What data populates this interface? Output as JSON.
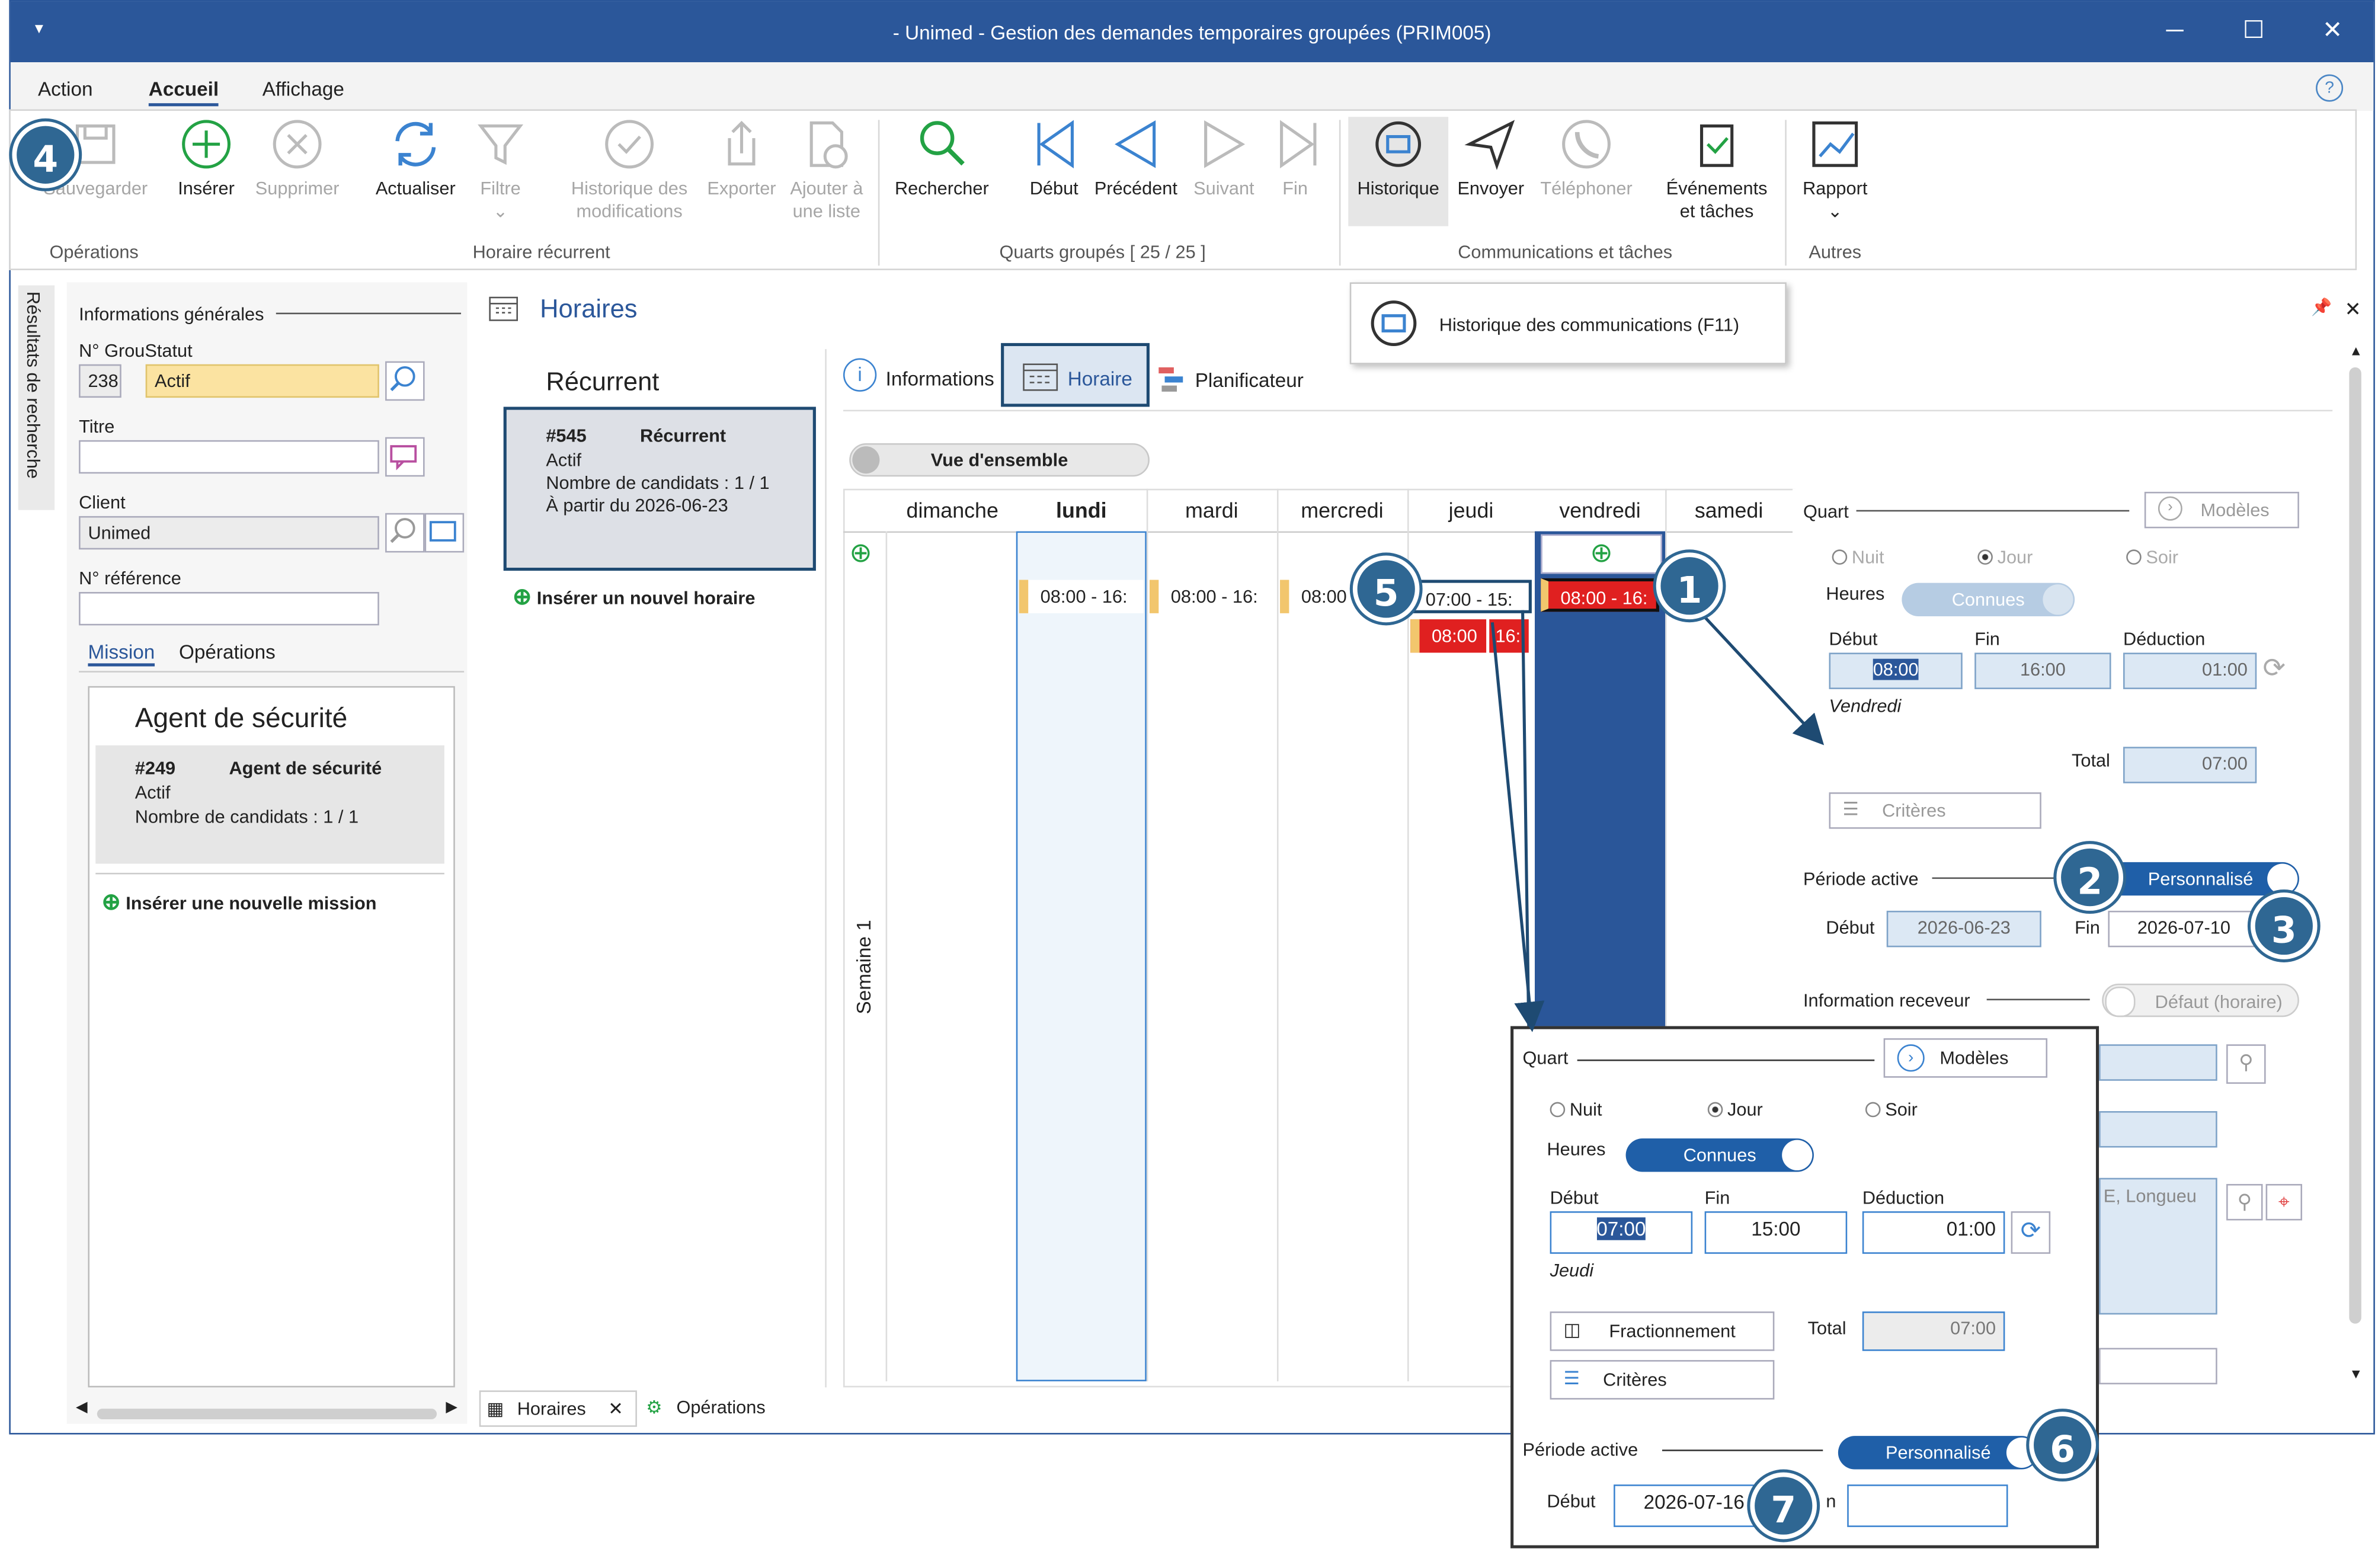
{
  "window": {
    "title": "- Unimed - Gestion des demandes temporaires groupées (PRIM005)",
    "minimize": "─",
    "maximize": "☐",
    "close": "✕",
    "quick": "▾"
  },
  "menu": {
    "items": [
      "Action",
      "Accueil",
      "Affichage"
    ],
    "help": "?"
  },
  "ribbon": {
    "save": "Sauvegarder",
    "insert": "Insérer",
    "delete": "Supprimer",
    "refresh": "Actualiser",
    "filter": "Filtre",
    "history_mod": [
      "Historique des",
      "modifications"
    ],
    "export": "Exporter",
    "add_list": [
      "Ajouter à",
      "une liste"
    ],
    "search": "Rechercher",
    "first": "Début",
    "previous": "Précédent",
    "next": "Suivant",
    "last": "Fin",
    "history": "Historique",
    "send": "Envoyer",
    "phone": "Téléphoner",
    "events": [
      "Événements",
      "et tâches"
    ],
    "report": "Rapport",
    "groups": {
      "operations": "Opérations",
      "recurring": "Horaire récurrent",
      "grouped": "Quarts groupés [ 25 / 25 ]",
      "comms": "Communications et tâches",
      "others": "Autres"
    }
  },
  "tooltip": "Historique des communications (F11)",
  "side_tab": "Résultats de recherche",
  "left": {
    "section": "Informations générales",
    "group_status": "N° GrouStatut",
    "group_no": "238",
    "status": "Actif",
    "title_label": "Titre",
    "title_value": "",
    "client_label": "Client",
    "client_value": "Unimed",
    "ref_label": "N° référence",
    "ref_value": "",
    "tabs": [
      "Mission",
      "Opérations"
    ],
    "mission_header": "Agent de sécurité",
    "mission": {
      "id": "#249",
      "name": "Agent de sécurité",
      "status": "Actif",
      "candidates": "Nombre de candidats : 1 / 1"
    },
    "insert_mission": "Insérer une nouvelle mission"
  },
  "horaires": {
    "title": "Horaires",
    "pin": "📌",
    "close": "✕"
  },
  "recurrent": {
    "header": "Récurrent",
    "card": {
      "id": "#545",
      "type": "Récurrent",
      "status": "Actif",
      "candidates": "Nombre de candidats : 1 / 1",
      "from": "À partir du 2026-06-23"
    },
    "insert": "Insérer un nouvel horaire"
  },
  "subtabs": {
    "info": "Informations",
    "schedule": "Horaire",
    "planner": "Planificateur"
  },
  "overview": "Vue d'ensemble",
  "calendar": {
    "days": [
      "dimanche",
      "lundi",
      "mardi",
      "mercredi",
      "jeudi",
      "vendredi",
      "samedi"
    ],
    "week": "Semaine 1",
    "chips": {
      "lundi": "08:00 - 16:",
      "mardi": "08:00 - 16:",
      "mercredi": "08:00",
      "jeudi": "07:00 - 15:",
      "jeudi2a": "08:00",
      "jeudi2b": "16:",
      "vendredi": "08:00 - 16:"
    }
  },
  "shift": {
    "quart": "Quart",
    "models": "Modèles",
    "night": "Nuit",
    "day": "Jour",
    "evening": "Soir",
    "hours": "Heures",
    "known": "Connues",
    "start_lbl": "Début",
    "end_lbl": "Fin",
    "deduct_lbl": "Déduction",
    "start": "08:00",
    "end": "16:00",
    "deduct": "01:00",
    "weekday": "Vendredi",
    "total_lbl": "Total",
    "total": "07:00",
    "criteria": "Critères",
    "period": "Période active",
    "custom": "Personnalisé",
    "period_start_lbl": "Début",
    "period_start": "2026-06-23",
    "period_end_lbl": "Fin",
    "period_end": "2026-07-10",
    "receiver": "Information receveur",
    "default": "Défaut (horaire)",
    "address_frag": "E,  Longueu"
  },
  "popup": {
    "quart": "Quart",
    "models": "Modèles",
    "night": "Nuit",
    "day": "Jour",
    "evening": "Soir",
    "hours": "Heures",
    "known": "Connues",
    "start_lbl": "Début",
    "end_lbl": "Fin",
    "deduct_lbl": "Déduction",
    "start": "07:00",
    "end": "15:00",
    "deduct": "01:00",
    "weekday": "Jeudi",
    "split": "Fractionnement",
    "criteria": "Critères",
    "total_lbl": "Total",
    "total": "07:00",
    "period": "Période active",
    "custom": "Personnalisé",
    "period_start_lbl": "Début",
    "period_start": "2026-07-16",
    "period_end_frag": "n",
    "period_end": ""
  },
  "bottom_tabs": {
    "schedules": "Horaires",
    "operations": "Opérations",
    "close": "✕"
  },
  "badges": [
    "1",
    "2",
    "3",
    "4",
    "5",
    "6",
    "7"
  ],
  "colors": {
    "accent": "#2b579a",
    "selected_day": "#2a5699",
    "chip_red": "#e02020",
    "badge": "#2f6793",
    "status_yellow": "#fbe3a1"
  }
}
